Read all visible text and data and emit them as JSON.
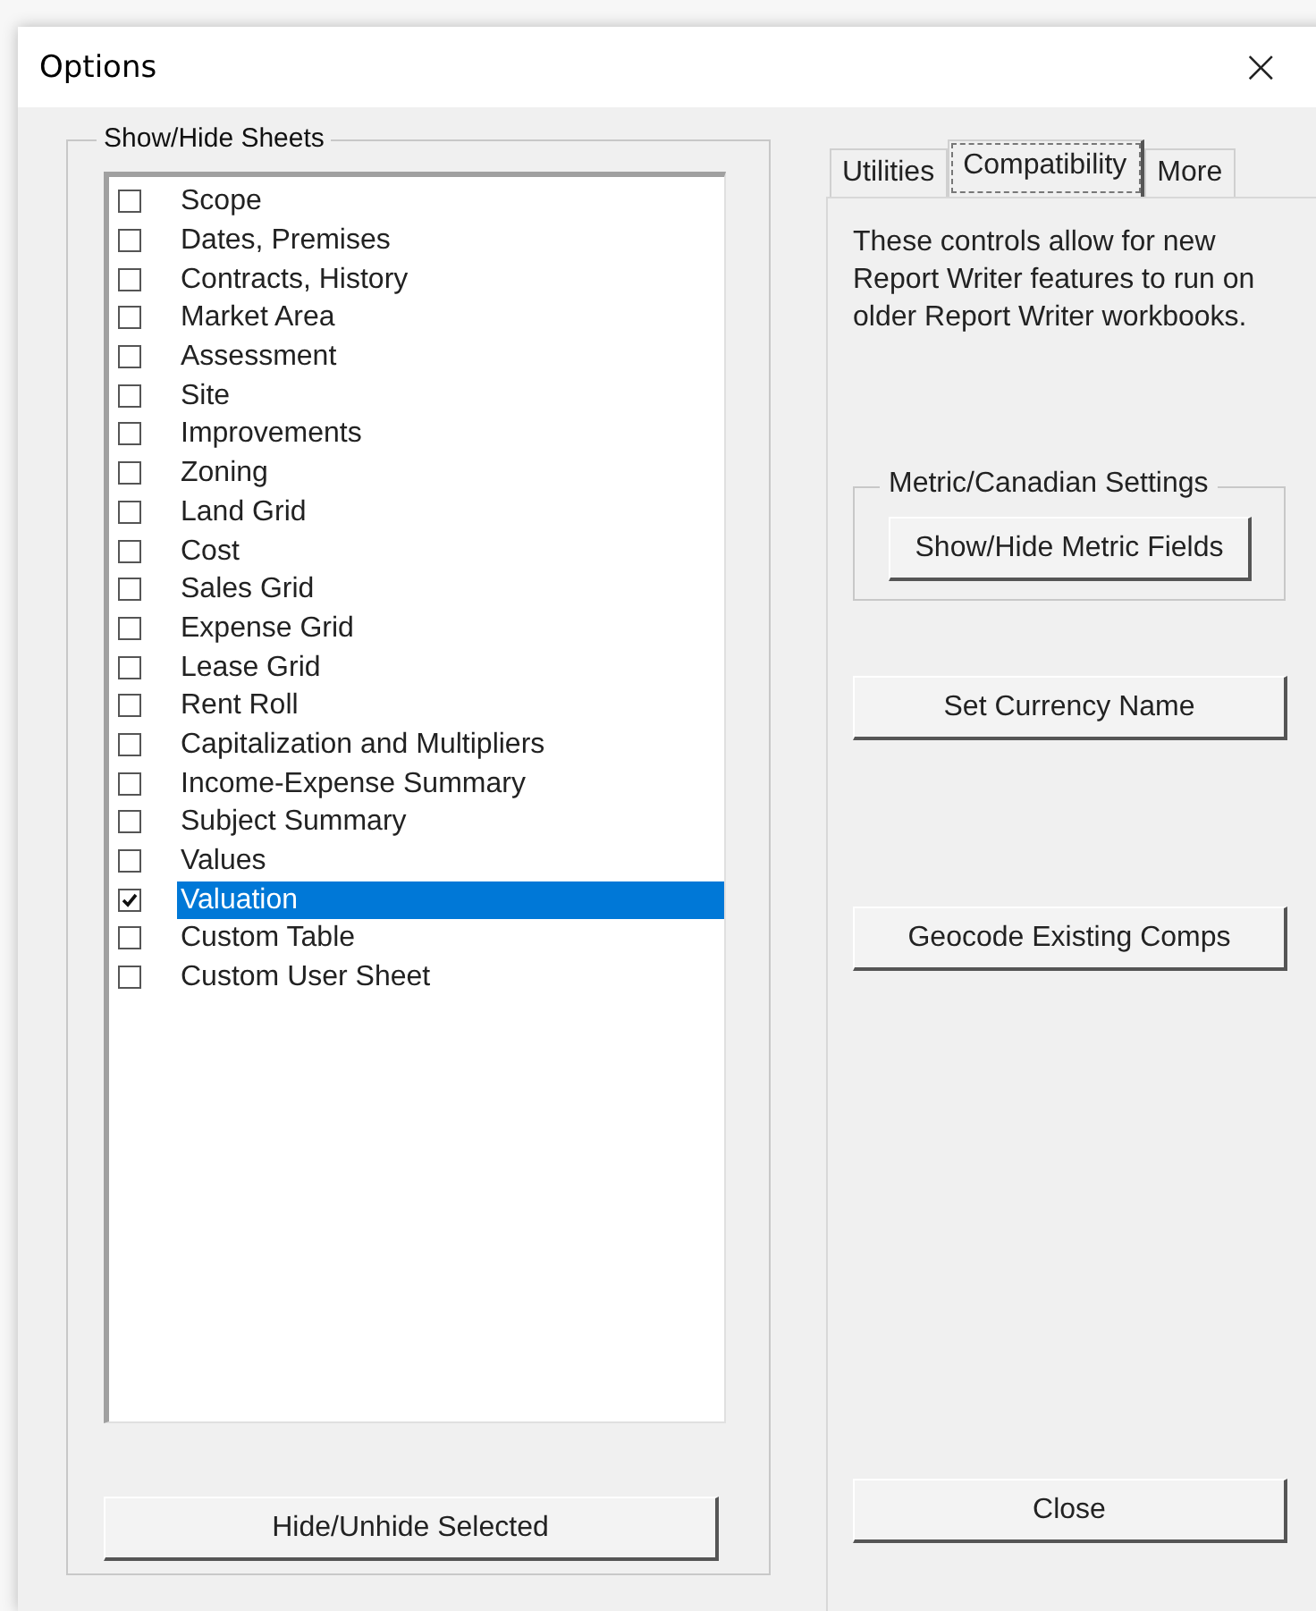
{
  "window": {
    "title": "Options",
    "close": "×"
  },
  "sheets": {
    "title": "Show/Hide Sheets",
    "items": [
      {
        "label": "Scope",
        "checked": false,
        "selected": false
      },
      {
        "label": "Dates, Premises",
        "checked": false,
        "selected": false
      },
      {
        "label": "Contracts, History",
        "checked": false,
        "selected": false
      },
      {
        "label": "Market Area",
        "checked": false,
        "selected": false
      },
      {
        "label": "Assessment",
        "checked": false,
        "selected": false
      },
      {
        "label": "Site",
        "checked": false,
        "selected": false
      },
      {
        "label": "Improvements",
        "checked": false,
        "selected": false
      },
      {
        "label": "Zoning",
        "checked": false,
        "selected": false
      },
      {
        "label": "Land Grid",
        "checked": false,
        "selected": false
      },
      {
        "label": "Cost",
        "checked": false,
        "selected": false
      },
      {
        "label": "Sales Grid",
        "checked": false,
        "selected": false
      },
      {
        "label": "Expense Grid",
        "checked": false,
        "selected": false
      },
      {
        "label": "Lease Grid",
        "checked": false,
        "selected": false
      },
      {
        "label": "Rent Roll",
        "checked": false,
        "selected": false
      },
      {
        "label": "Capitalization and Multipliers",
        "checked": false,
        "selected": false
      },
      {
        "label": "Income-Expense Summary",
        "checked": false,
        "selected": false
      },
      {
        "label": "Subject Summary",
        "checked": false,
        "selected": false
      },
      {
        "label": "Values",
        "checked": false,
        "selected": false
      },
      {
        "label": "Valuation",
        "checked": true,
        "selected": true
      },
      {
        "label": "Custom Table",
        "checked": false,
        "selected": false
      },
      {
        "label": "Custom User Sheet",
        "checked": false,
        "selected": false
      }
    ],
    "button": "Hide/Unhide Selected"
  },
  "tabs": [
    {
      "label": "Utilities",
      "selected": false
    },
    {
      "label": "Compatibility",
      "selected": true
    },
    {
      "label": "More",
      "selected": false
    }
  ],
  "panel": {
    "description": "These controls allow for new Report Writer features to run on older Report Writer workbooks.",
    "group": {
      "title": "Metric/Canadian Settings",
      "button": "Show/Hide Metric Fields"
    },
    "buttons": [
      "Set Currency Name",
      "Geocode Existing Comps"
    ],
    "close_button": "Close"
  }
}
